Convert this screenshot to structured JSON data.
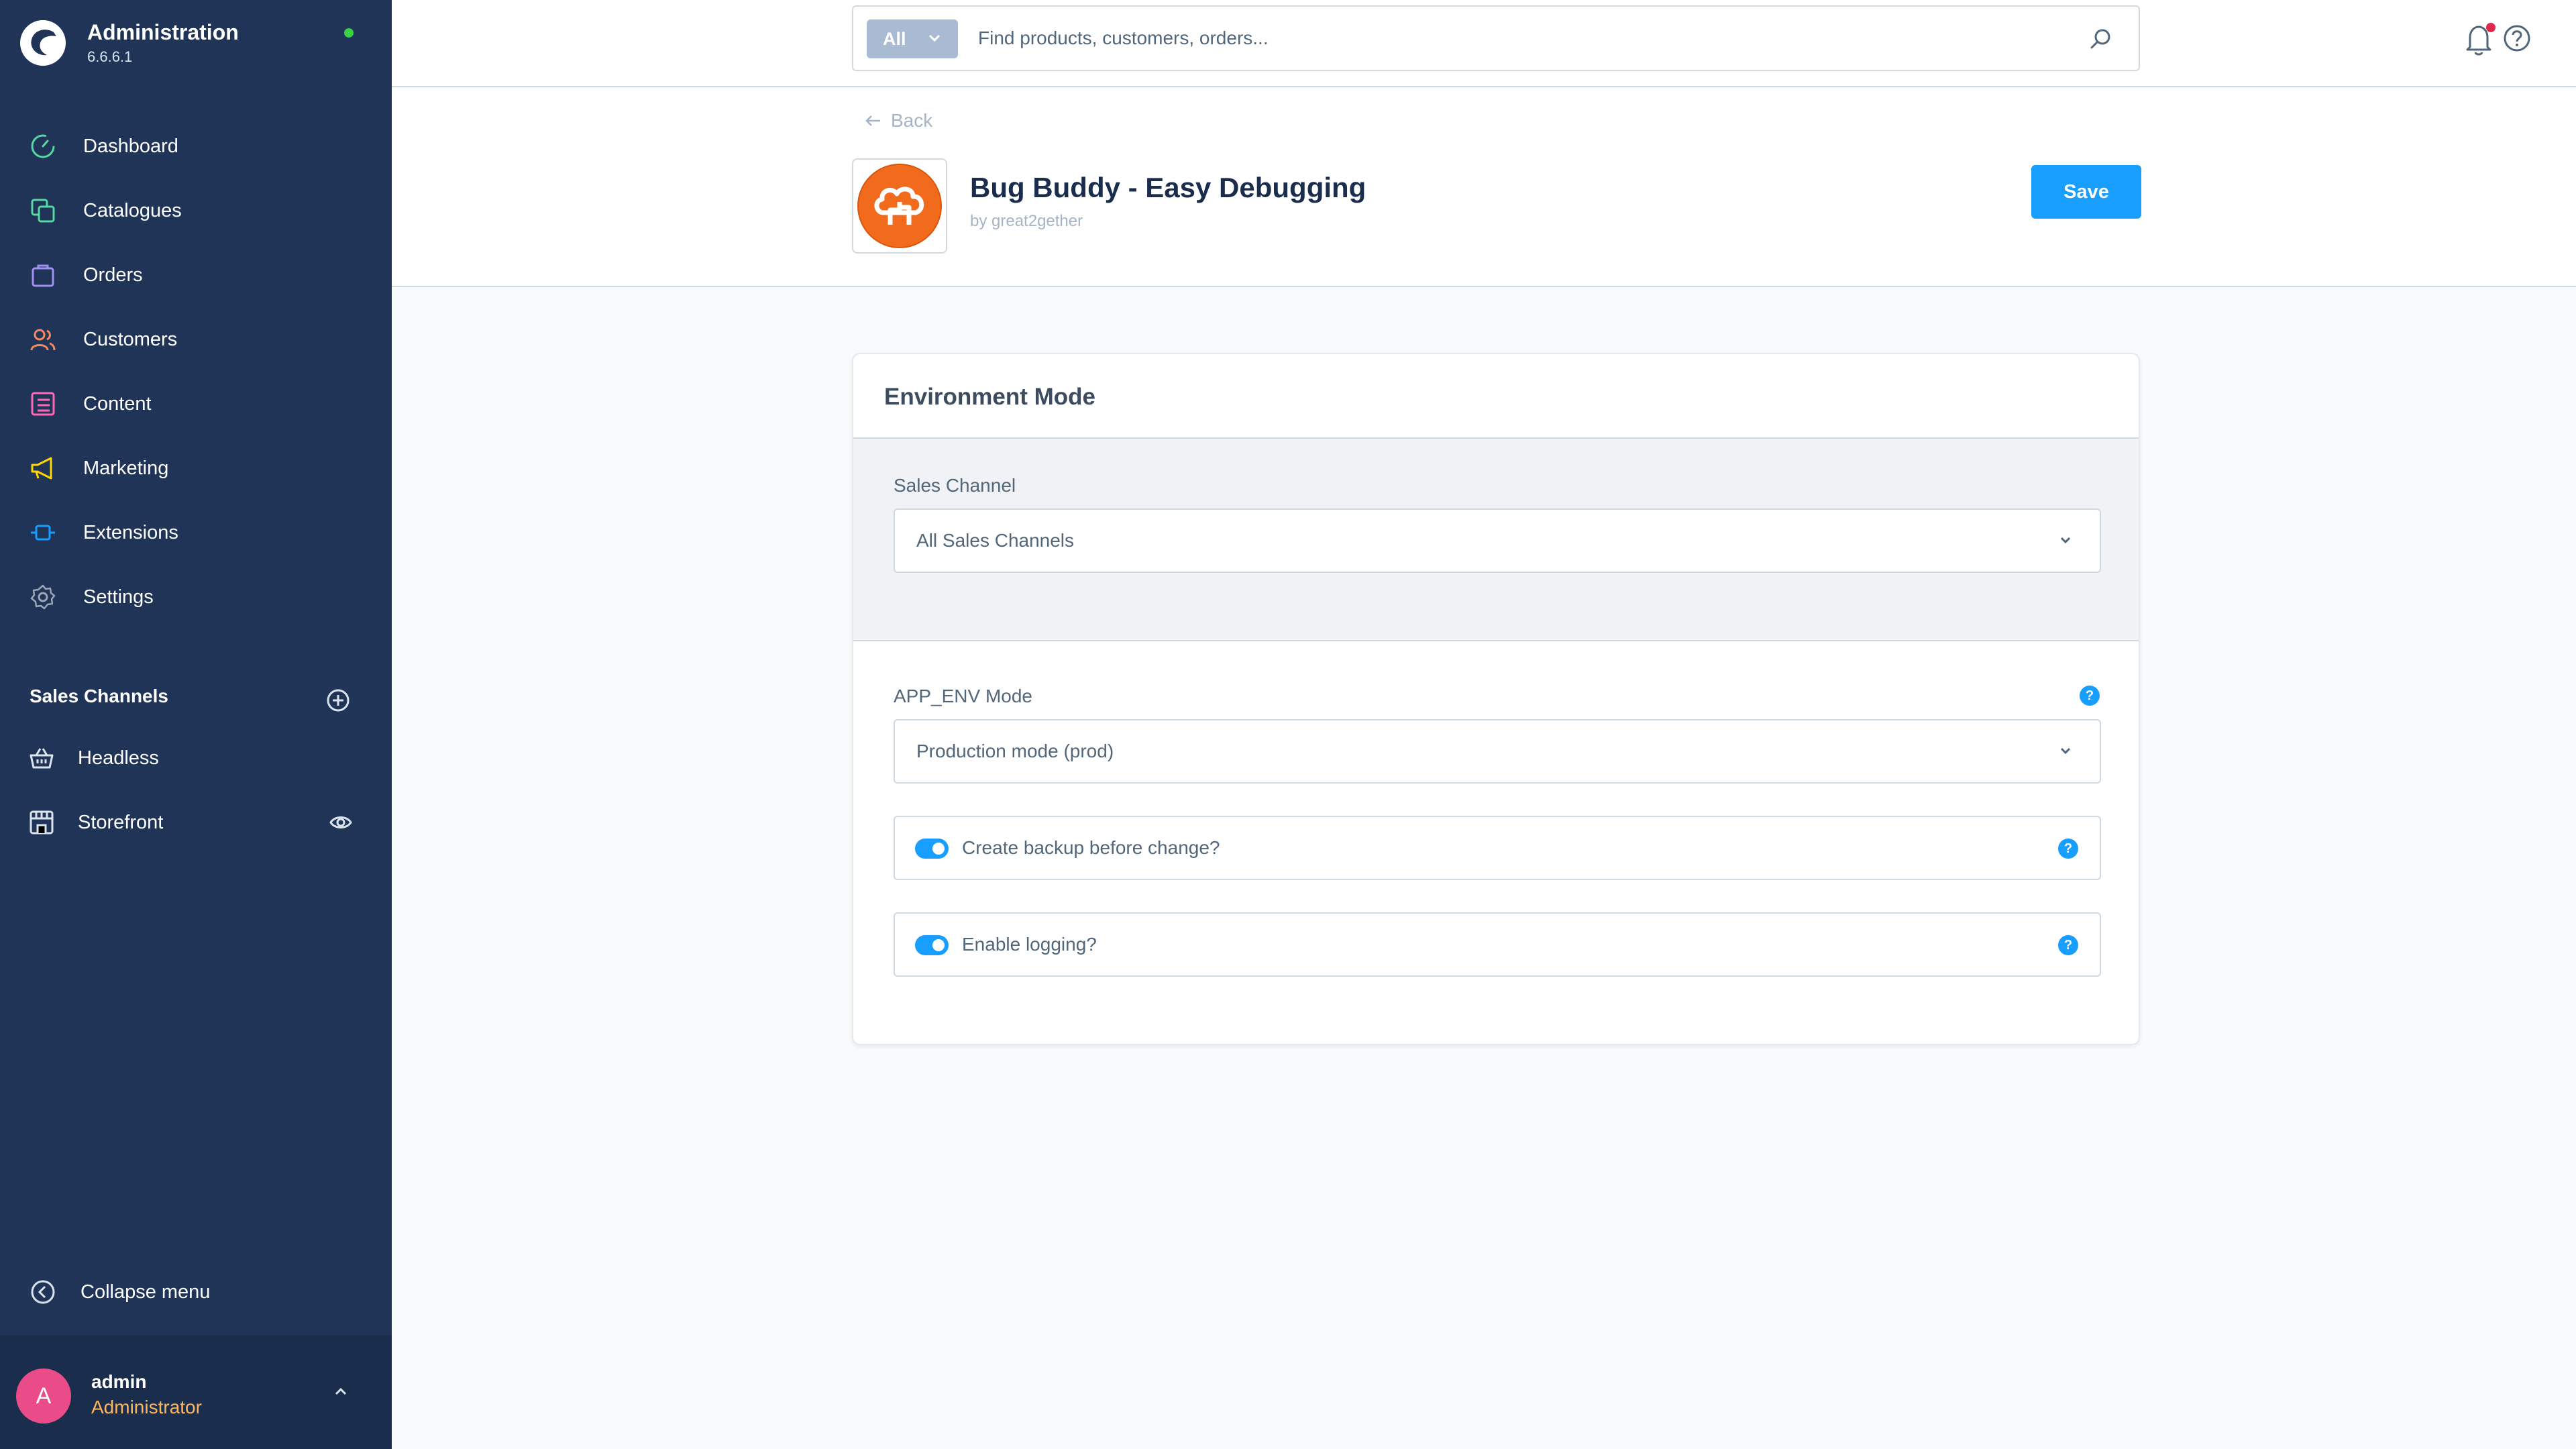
{
  "app": {
    "title": "Administration",
    "version": "6.6.6.1"
  },
  "nav": {
    "items": [
      {
        "label": "Dashboard",
        "icon": "dashboard-icon",
        "color": "#57d9a3"
      },
      {
        "label": "Catalogues",
        "icon": "catalogue-icon",
        "color": "#57d9a3"
      },
      {
        "label": "Orders",
        "icon": "orders-icon",
        "color": "#a092f0"
      },
      {
        "label": "Customers",
        "icon": "customers-icon",
        "color": "#f88962"
      },
      {
        "label": "Content",
        "icon": "content-icon",
        "color": "#ff68b4"
      },
      {
        "label": "Marketing",
        "icon": "marketing-icon",
        "color": "#ffd700"
      },
      {
        "label": "Extensions",
        "icon": "extensions-icon",
        "color": "#189eff"
      },
      {
        "label": "Settings",
        "icon": "settings-icon",
        "color": "#9aa8b5"
      }
    ]
  },
  "sales_channels": {
    "heading": "Sales Channels",
    "items": [
      {
        "label": "Headless"
      },
      {
        "label": "Storefront"
      }
    ]
  },
  "collapse_label": "Collapse menu",
  "user": {
    "initial": "A",
    "name": "admin",
    "role": "Administrator"
  },
  "search": {
    "type_label": "All",
    "placeholder": "Find products, customers, orders..."
  },
  "header": {
    "back_label": "Back",
    "plugin_title": "Bug Buddy - Easy Debugging",
    "plugin_author": "by great2gether",
    "save_label": "Save"
  },
  "card": {
    "title": "Environment Mode",
    "sales_channel_label": "Sales Channel",
    "sales_channel_value": "All Sales Channels",
    "app_env_label": "APP_ENV Mode",
    "app_env_value": "Production mode (prod)",
    "backup_label": "Create backup before change?",
    "backup_enabled": true,
    "logging_label": "Enable logging?",
    "logging_enabled": true,
    "help_glyph": "?"
  },
  "colors": {
    "sidebar": "#1f3456",
    "accent": "#189eff",
    "online": "#37d046",
    "avatar": "#ea4c89",
    "role": "#ffb75d",
    "plugin_logo": "#f26b1d"
  }
}
